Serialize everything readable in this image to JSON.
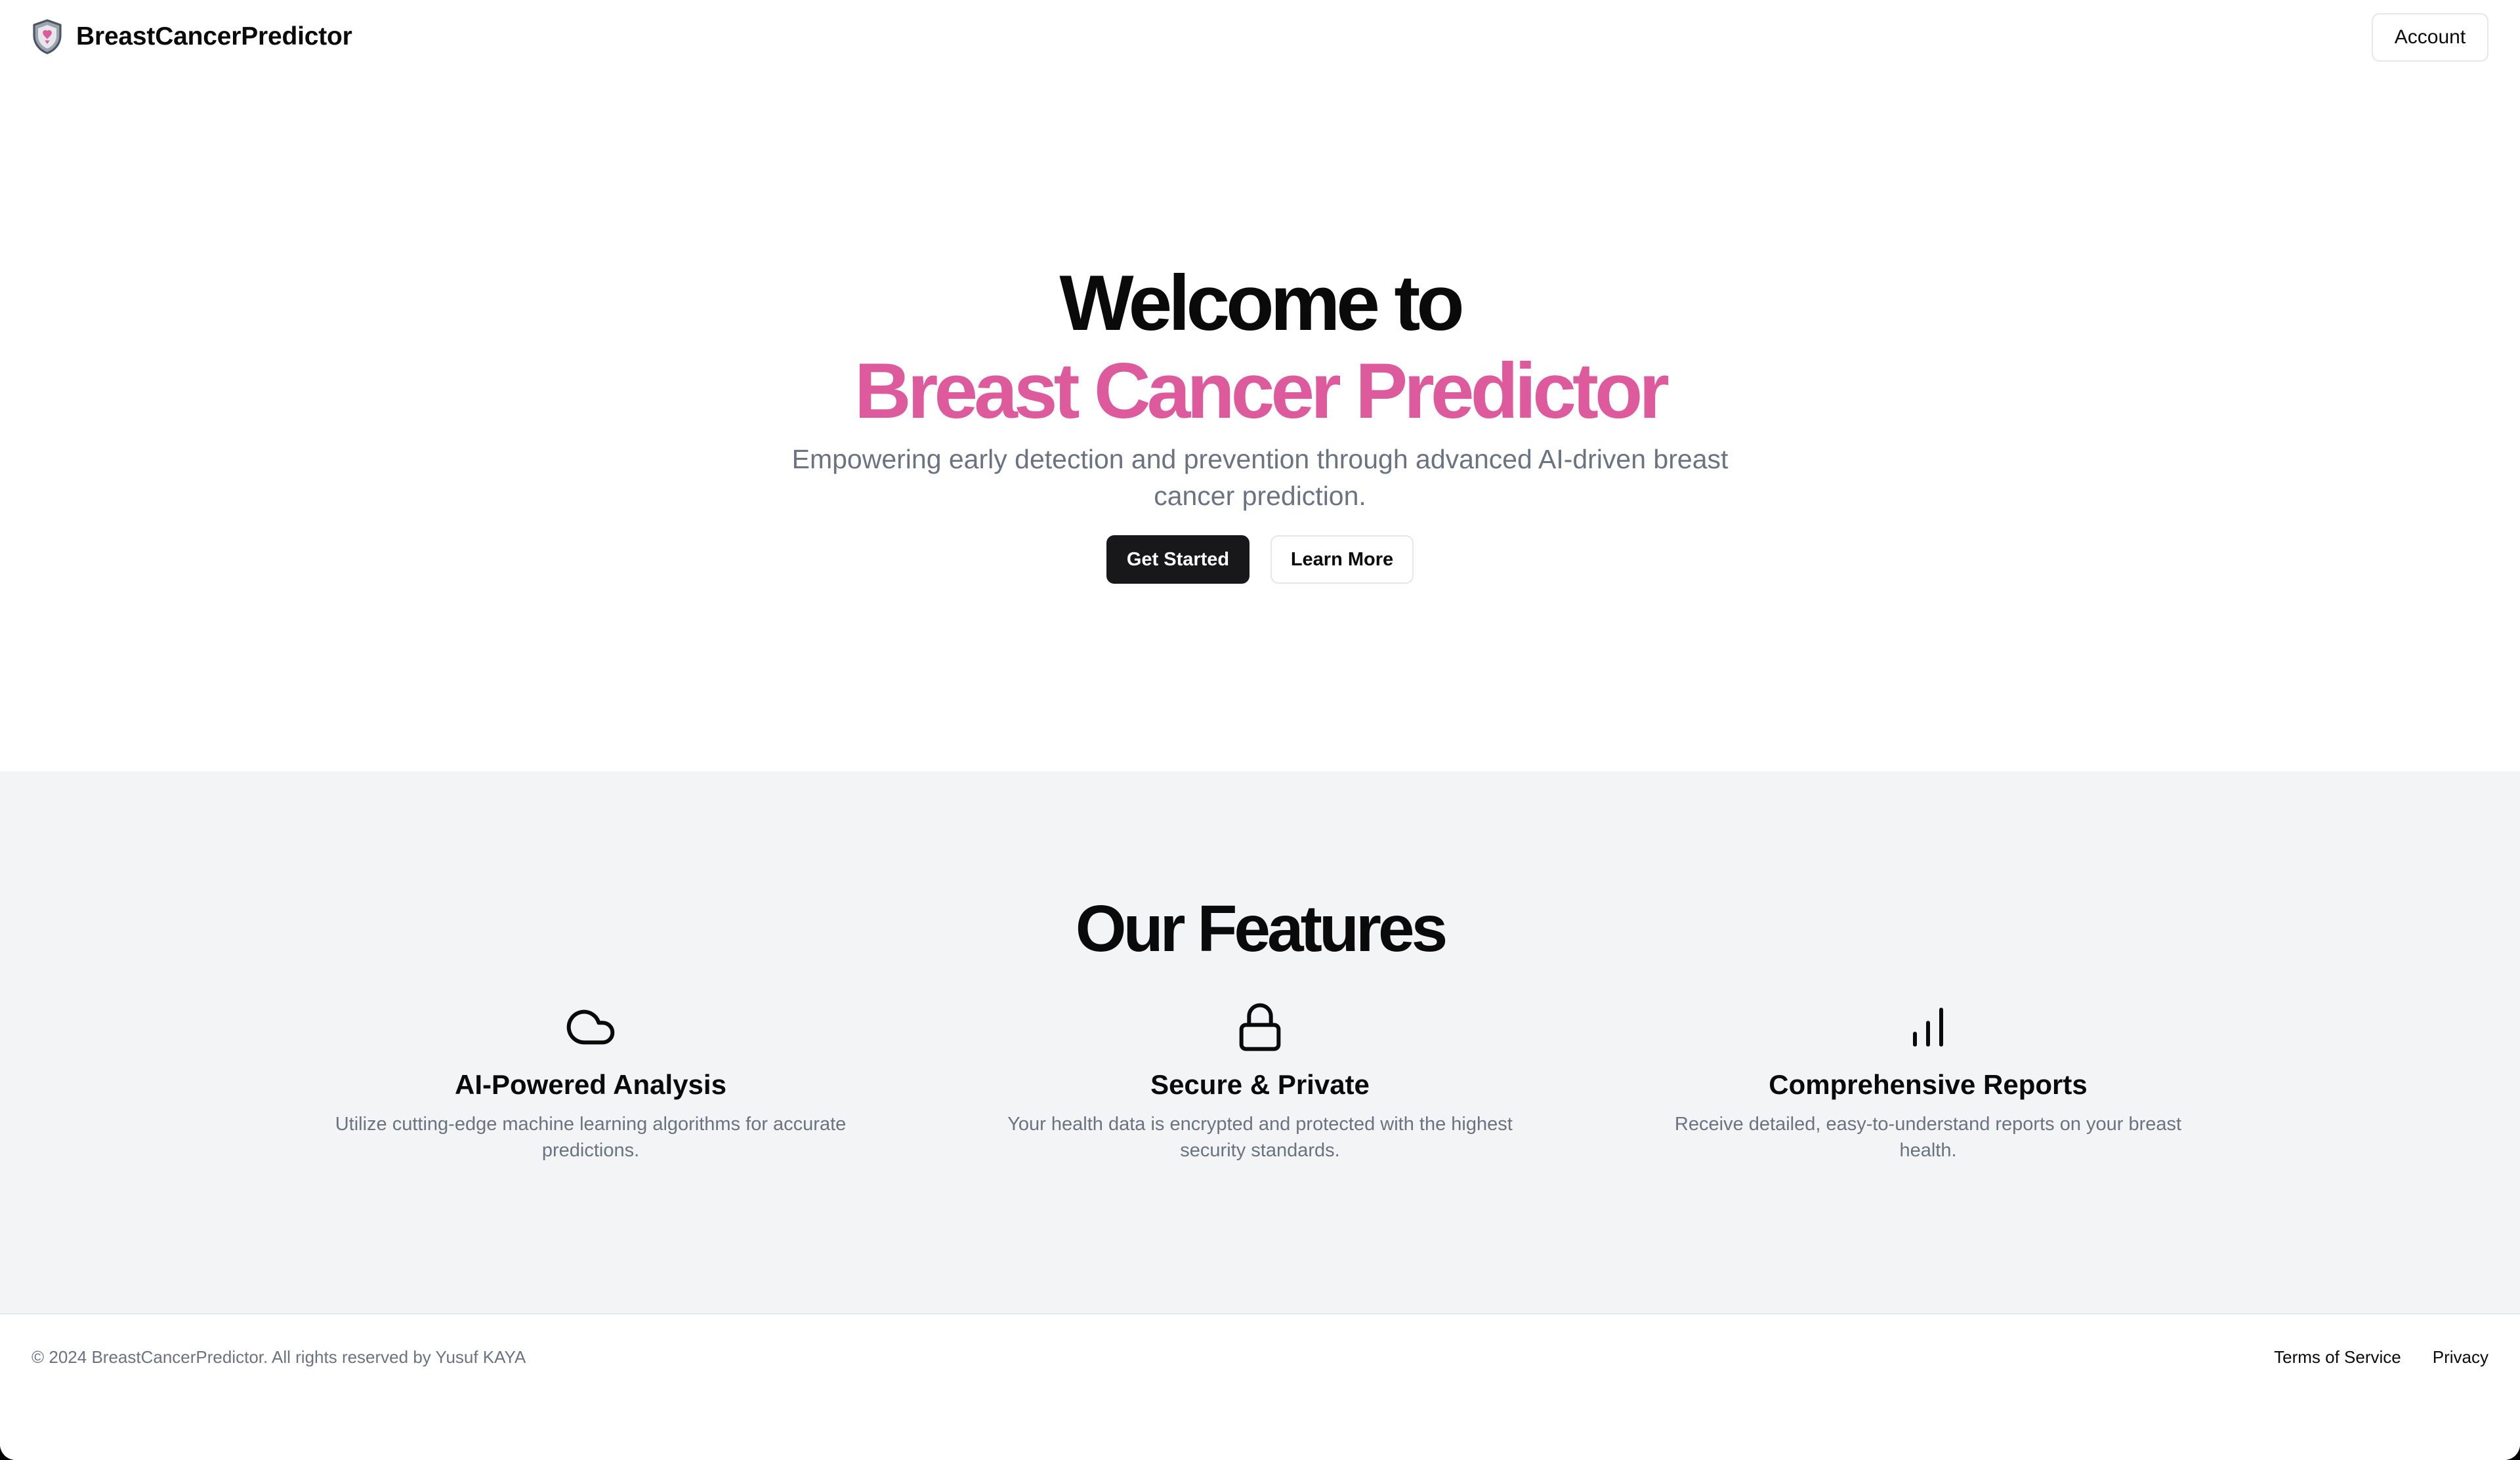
{
  "header": {
    "brand_name": "BreastCancerPredictor",
    "account_label": "Account"
  },
  "hero": {
    "title_line1": "Welcome to",
    "title_line2": "Breast Cancer Predictor",
    "subtitle": "Empowering early detection and prevention through advanced AI-driven breast cancer prediction.",
    "primary_button": "Get Started",
    "secondary_button": "Learn More"
  },
  "features": {
    "title": "Our Features",
    "items": [
      {
        "icon": "cloud-icon",
        "title": "AI-Powered Analysis",
        "description": "Utilize cutting-edge machine learning algorithms for accurate predictions."
      },
      {
        "icon": "lock-icon",
        "title": "Secure & Private",
        "description": "Your health data is encrypted and protected with the highest security standards."
      },
      {
        "icon": "bar-chart-icon",
        "title": "Comprehensive Reports",
        "description": "Receive detailed, easy-to-understand reports on your breast health."
      }
    ]
  },
  "footer": {
    "copyright": "© 2024 BreastCancerPredictor. All rights reserved by Yusuf KAYA",
    "links": [
      "Terms of Service",
      "Privacy"
    ]
  },
  "colors": {
    "accent_pink": "#dd5a9c",
    "primary_dark": "#18181b",
    "muted_text": "#6b7280",
    "section_bg": "#f3f4f6"
  }
}
